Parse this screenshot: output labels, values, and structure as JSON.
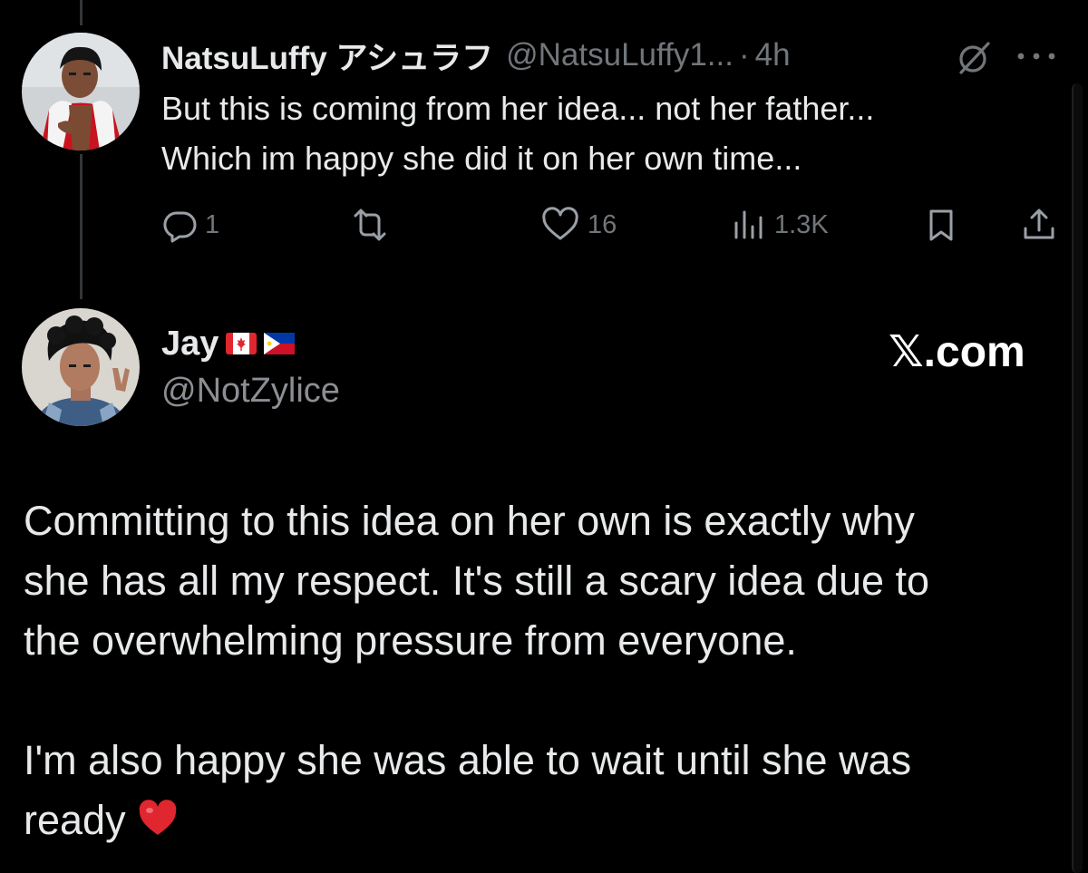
{
  "reply_tweet": {
    "author_name": "NatsuLuffy アシュラフ",
    "author_handle": "@NatsuLuffy1...",
    "separator": "·",
    "time_ago": "4h",
    "text_lines": [
      "But this is coming from her idea... not her father...",
      "Which im happy she did it on her own time..."
    ],
    "actions": {
      "reply_count": "1",
      "retweet_count": "",
      "like_count": "16",
      "view_count": "1.3K"
    },
    "icons": [
      "grok-icon",
      "more-icon",
      "reply-icon",
      "retweet-icon",
      "like-icon",
      "views-icon",
      "bookmark-icon",
      "share-icon"
    ]
  },
  "main_tweet": {
    "author_name": "Jay",
    "author_flags": [
      "canada-flag",
      "philippines-flag"
    ],
    "author_handle": "@NotZylice",
    "watermark": "𝕏.com",
    "paragraph1_lines": [
      "Committing to this idea on her own is exactly why",
      "she has all my respect. It's still a scary idea due to",
      "the overwhelming pressure from everyone."
    ],
    "paragraph2_lines": [
      "I'm also happy she was able to wait until she was",
      "ready"
    ],
    "emoji": "red-heart-emoji"
  },
  "colors": {
    "background": "#000000",
    "primary_text": "#e7e9ea",
    "secondary_text": "#71767b",
    "thread_line": "#333639",
    "heart_red": "#e0262f"
  }
}
